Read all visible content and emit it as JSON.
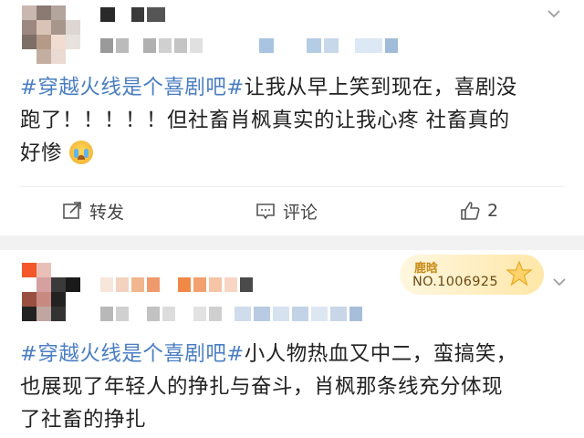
{
  "post1": {
    "text_tag": "#穿越火线是个喜剧吧#",
    "text_line1_rest": "让我从早上笑到现在，喜剧没",
    "text_line2": "跑了！！！！！但社畜肖枫真实的让我心疼 社畜真的",
    "text_line3": "好惨",
    "emoji": "crying-face-icon",
    "actions": {
      "repost_label": "转发",
      "comment_label": "评论",
      "like_count": "2"
    }
  },
  "post2": {
    "badge": {
      "name": "鹿晗",
      "number": "NO.1006925"
    },
    "text_tag": "#穿越火线是个喜剧吧#",
    "text_line1_rest": "小人物热血又中二，蛮搞笑，",
    "text_line2": "也展现了年轻人的挣扎与奋斗，肖枫那条线充分体现",
    "text_line3": "了社畜的挣扎"
  },
  "colors": {
    "hashtag": "#4a7ec2",
    "separator": "#f2f2f2",
    "badge_gold": "#c98a14"
  }
}
